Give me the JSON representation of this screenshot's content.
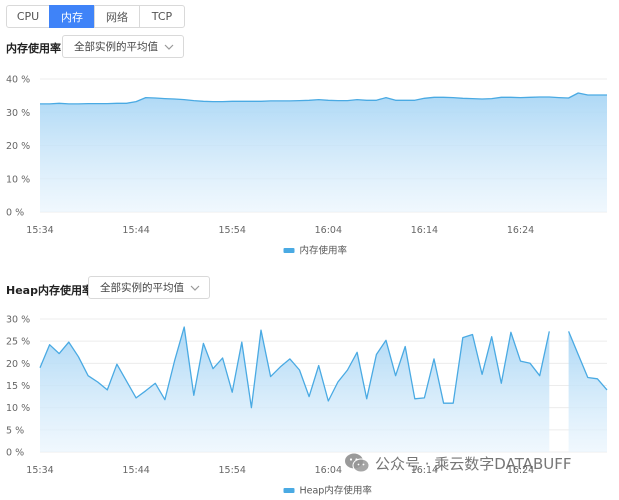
{
  "tabs": [
    {
      "label": "CPU",
      "active": false
    },
    {
      "label": "内存",
      "active": true
    },
    {
      "label": "网络",
      "active": false
    },
    {
      "label": "TCP",
      "active": false
    }
  ],
  "panels": [
    {
      "title": "内存使用率",
      "selector": "全部实例的平均值"
    },
    {
      "title": "Heap内存使用率",
      "selector": "全部实例的平均值"
    }
  ],
  "watermark": {
    "text": "公众号 · 乘云数字DATABUFF",
    "icon": "wechat-icon"
  },
  "colors": {
    "line": "#4aaae3",
    "fill_top": "#a9d6f5",
    "fill_bottom": "#eaf5fd",
    "grid": "#ececec",
    "accent": "#3f83f8"
  },
  "chart_data": [
    {
      "type": "area",
      "title": "",
      "xlabel": "",
      "ylabel": "",
      "ylim": [
        0,
        40
      ],
      "yticks": [
        0,
        10,
        20,
        30,
        40
      ],
      "ytick_labels": [
        "0 %",
        "10 %",
        "20 %",
        "30 %",
        "40 %"
      ],
      "xlim": [
        0,
        59
      ],
      "xticks": [
        0,
        10,
        20,
        30,
        40,
        50
      ],
      "xtick_labels": [
        "15:34",
        "15:44",
        "15:54",
        "16:04",
        "16:14",
        "16:24"
      ],
      "grid": true,
      "legend": "bottom-center",
      "series": [
        {
          "name": "内存使用率",
          "x": [
            0,
            1,
            2,
            3,
            4,
            5,
            6,
            7,
            8,
            9,
            10,
            11,
            12,
            13,
            14,
            15,
            16,
            17,
            18,
            19,
            20,
            21,
            22,
            23,
            24,
            25,
            26,
            27,
            28,
            29,
            30,
            31,
            32,
            33,
            34,
            35,
            36,
            37,
            38,
            39,
            40,
            41,
            42,
            43,
            44,
            45,
            46,
            47,
            48,
            49,
            50,
            51,
            52,
            53,
            54,
            55,
            56,
            57,
            58,
            59
          ],
          "values": [
            32.5,
            32.5,
            32.7,
            32.5,
            32.5,
            32.6,
            32.6,
            32.6,
            32.7,
            32.7,
            33.2,
            34.4,
            34.3,
            34.1,
            34.0,
            33.8,
            33.5,
            33.3,
            33.2,
            33.2,
            33.3,
            33.3,
            33.3,
            33.3,
            33.4,
            33.4,
            33.4,
            33.5,
            33.6,
            33.8,
            33.6,
            33.5,
            33.5,
            33.8,
            33.6,
            33.6,
            34.4,
            33.6,
            33.6,
            33.6,
            34.2,
            34.5,
            34.5,
            34.4,
            34.2,
            34.1,
            34.0,
            34.1,
            34.5,
            34.5,
            34.4,
            34.5,
            34.6,
            34.6,
            34.4,
            34.3,
            35.8,
            35.2,
            35.2,
            35.2
          ]
        }
      ]
    },
    {
      "type": "area",
      "title": "",
      "xlabel": "",
      "ylabel": "",
      "ylim": [
        0,
        30
      ],
      "yticks": [
        0,
        5,
        10,
        15,
        20,
        25,
        30
      ],
      "ytick_labels": [
        "0 %",
        "5 %",
        "10 %",
        "15 %",
        "20 %",
        "25 %",
        "30 %"
      ],
      "xlim": [
        0,
        59
      ],
      "xticks": [
        0,
        10,
        20,
        30,
        40,
        50
      ],
      "xtick_labels": [
        "15:34",
        "15:44",
        "15:54",
        "16:04",
        "16:14",
        "16:24"
      ],
      "grid": true,
      "legend": "bottom-center",
      "series": [
        {
          "name": "Heap内存使用率",
          "x": [
            0,
            1,
            2,
            3,
            4,
            5,
            6,
            7,
            8,
            9,
            10,
            11,
            12,
            13,
            14,
            15,
            16,
            17,
            18,
            19,
            20,
            21,
            22,
            23,
            24,
            25,
            26,
            27,
            28,
            29,
            30,
            31,
            32,
            33,
            34,
            35,
            36,
            37,
            38,
            39,
            40,
            41,
            42,
            43,
            44,
            45,
            46,
            47,
            48,
            49,
            50,
            51,
            52,
            53,
            54,
            55,
            56,
            57,
            58,
            59
          ],
          "values": [
            19.0,
            24.2,
            22.2,
            24.8,
            21.5,
            17.2,
            15.8,
            14.0,
            19.8,
            16.0,
            12.2,
            13.8,
            15.5,
            11.8,
            20.5,
            28.2,
            12.8,
            24.5,
            18.8,
            21.2,
            13.5,
            24.8,
            10.0,
            27.5,
            17.0,
            19.2,
            21.0,
            18.5,
            12.5,
            19.5,
            11.5,
            15.8,
            18.5,
            22.5,
            12.0,
            22.0,
            25.2,
            17.2,
            23.8,
            12.0,
            12.2,
            21.0,
            11.0,
            11.0,
            25.8,
            26.5,
            17.5,
            26.0,
            15.5,
            27.0,
            20.5,
            20.0,
            17.2,
            27.2,
            null,
            27.2,
            22.0,
            16.8,
            16.5,
            14.0
          ]
        }
      ]
    }
  ]
}
